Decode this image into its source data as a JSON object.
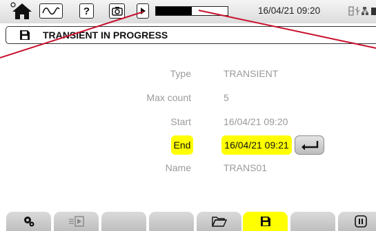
{
  "statusbar": {
    "datetime": "16/04/21 09:20",
    "record_progress": 0.5,
    "icons": [
      "home-icon",
      "waveform-icon",
      "help-icon",
      "screenshot-icon",
      "play-icon",
      "storage-icon",
      "usb-icon",
      "network-icon",
      "battery-icon"
    ]
  },
  "titlebar": {
    "title": "TRANSIENT IN PROGRESS",
    "icon": "save-icon"
  },
  "form": {
    "type_label": "Type",
    "type_value": "TRANSIENT",
    "maxcount_label": "Max count",
    "maxcount_value": "5",
    "start_label": "Start",
    "start_value": "16/04/21 09:20",
    "end_label": "End",
    "end_value": "16/04/21 09:21",
    "name_label": "Name",
    "name_value": "TRANS01"
  },
  "toolbar": {
    "tabs": [
      "settings-icon",
      "export-icon",
      "",
      "",
      "",
      "folder-icon",
      "save-icon",
      "",
      "pause-icon"
    ],
    "active": "save-icon"
  },
  "colors": {
    "highlight": "#ffff00",
    "callout": "#c8102e",
    "tab_gray": "#c8c8c8"
  }
}
